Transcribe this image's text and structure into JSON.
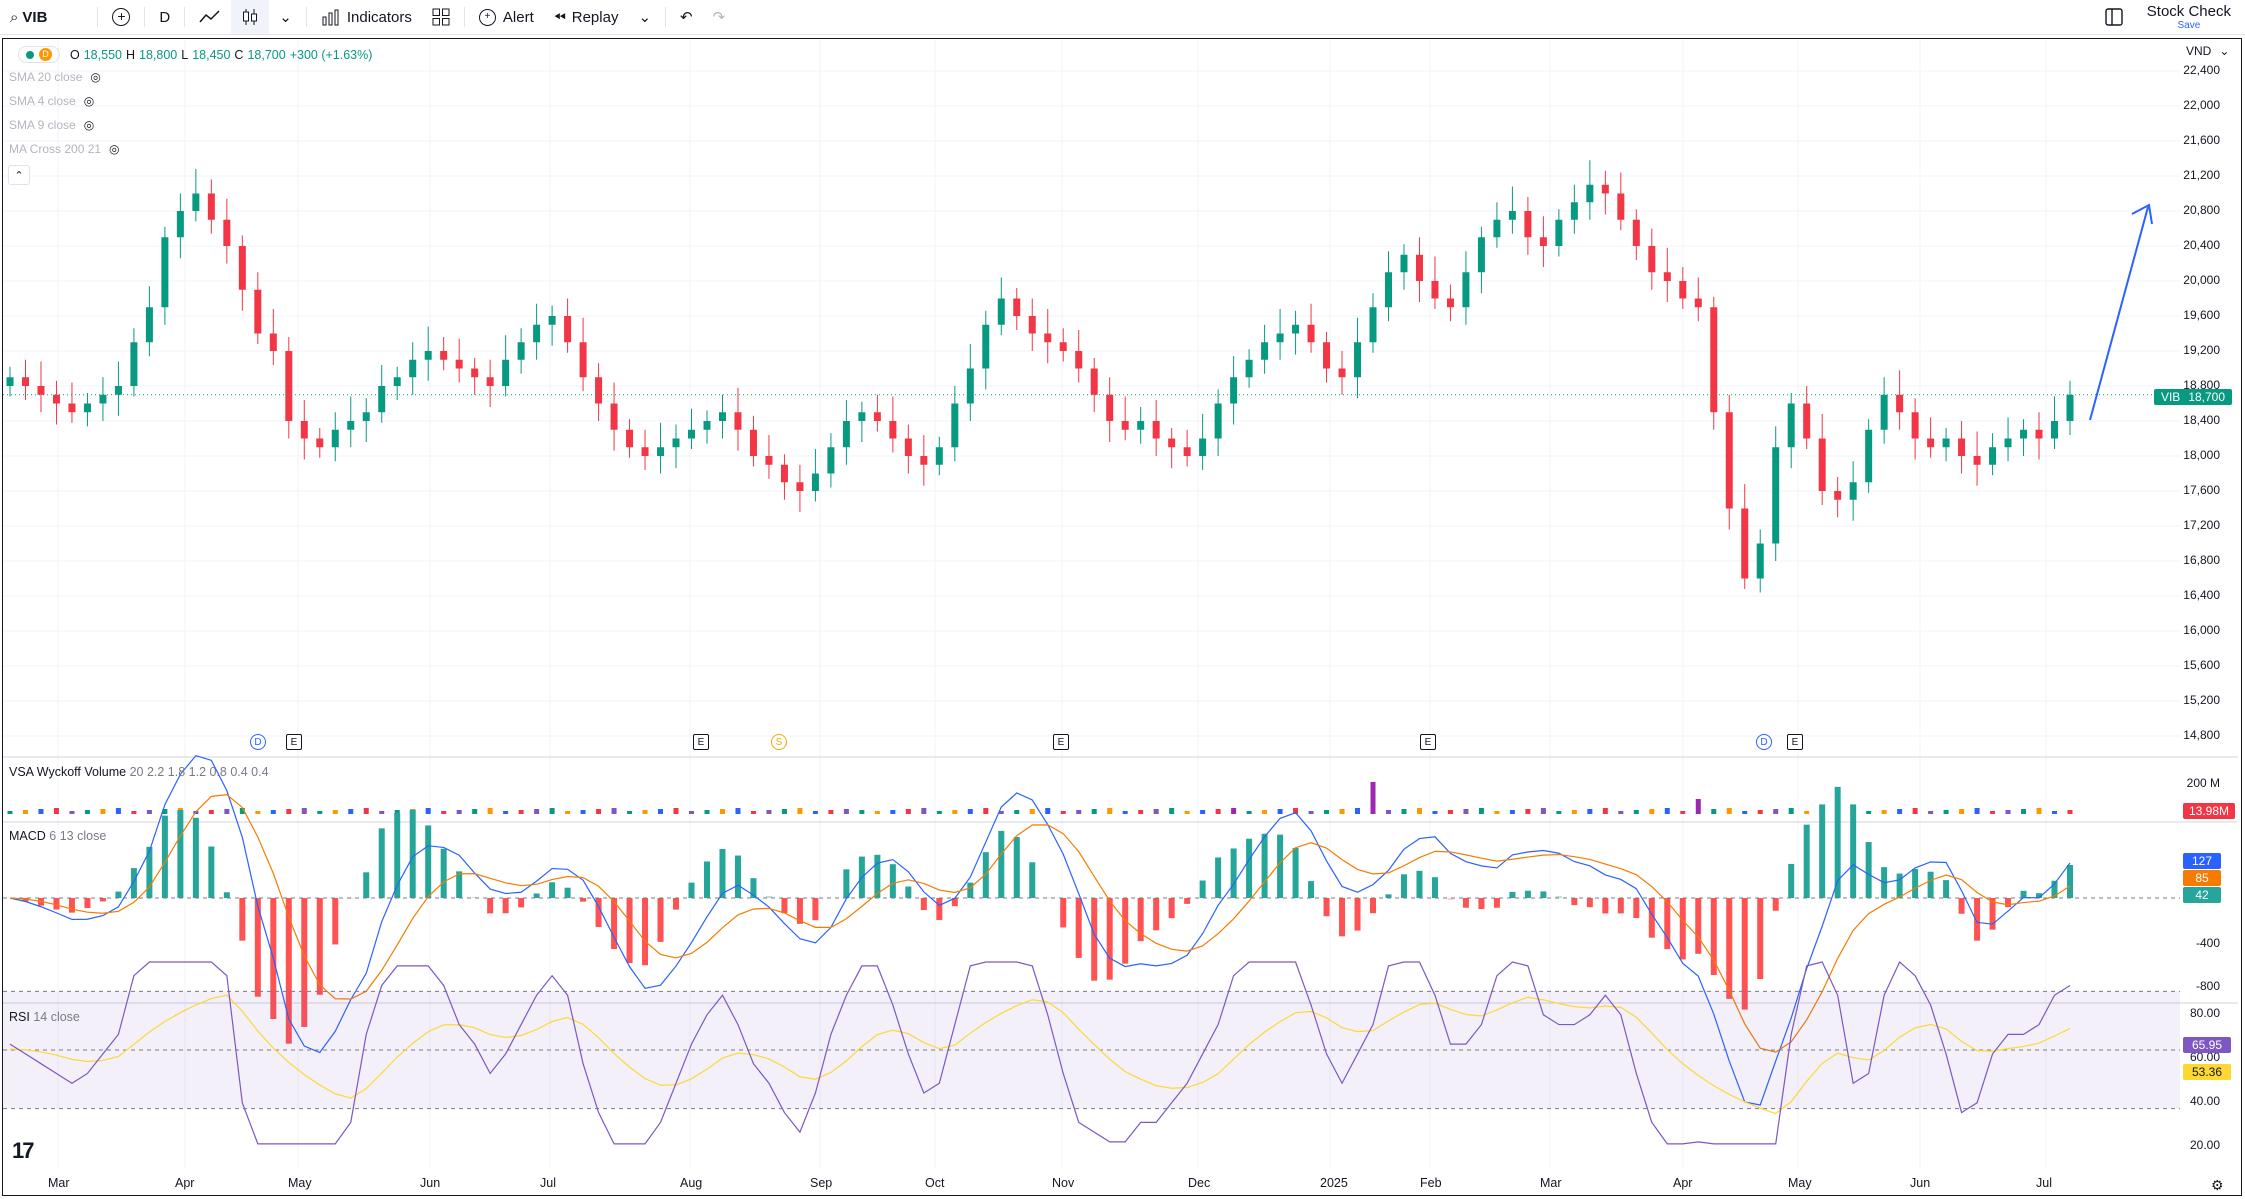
{
  "toolbar": {
    "symbol": "VIB",
    "interval": "D",
    "indicators_label": "Indicators",
    "alert_label": "Alert",
    "replay_label": "Replay",
    "layout_name": "Stock Check",
    "save_label": "Save"
  },
  "legend": {
    "interval_badge": "D",
    "open_label": "O",
    "open": "18,550",
    "high_label": "H",
    "high": "18,800",
    "low_label": "L",
    "low": "18,450",
    "close_label": "C",
    "close": "18,700",
    "change": "+300 (+1.63%)",
    "indicators": [
      "SMA 20 close",
      "SMA 4 close",
      "SMA 9 close",
      "MA Cross 200 21"
    ]
  },
  "currency": "VND",
  "price_axis": [
    "22,400",
    "22,000",
    "21,600",
    "21,200",
    "20,800",
    "20,400",
    "20,000",
    "19,600",
    "19,200",
    "18,800",
    "18,400",
    "18,000",
    "17,600",
    "17,200",
    "16,800",
    "16,400",
    "16,000",
    "15,600",
    "15,200",
    "14,800"
  ],
  "last_price_tag": {
    "symbol": "VIB",
    "price": "18,700",
    "color": "#089981"
  },
  "events": [
    {
      "type": "D",
      "shape": "circle",
      "color": "#2962ff"
    },
    {
      "type": "E",
      "shape": "square",
      "color": "#131722"
    },
    {
      "type": "E",
      "shape": "square",
      "color": "#131722"
    },
    {
      "type": "S",
      "shape": "circle",
      "color": "#f7a600"
    },
    {
      "type": "E",
      "shape": "square",
      "color": "#131722"
    },
    {
      "type": "E",
      "shape": "square",
      "color": "#131722"
    },
    {
      "type": "D",
      "shape": "circle",
      "color": "#2962ff"
    },
    {
      "type": "E",
      "shape": "square",
      "color": "#131722"
    }
  ],
  "volume_pane": {
    "title": "VSA Wyckoff Volume",
    "params": "20 2.2 1.8 1.2 0.8 0.4 0.4",
    "axis_label": "200 M",
    "last_tag": "13.98M"
  },
  "macd_pane": {
    "title": "MACD",
    "params": "6 13 close",
    "axis_labels": [
      "-400",
      "-800"
    ],
    "tags": [
      {
        "value": "127",
        "color": "#2962ff"
      },
      {
        "value": "85",
        "color": "#f57c00"
      },
      {
        "value": "42",
        "color": "#26a69a"
      }
    ]
  },
  "rsi_pane": {
    "title": "RSI",
    "params": "14 close",
    "axis_labels": [
      "80.00",
      "60.00",
      "40.00",
      "20.00"
    ],
    "tags": [
      {
        "value": "65.95",
        "color": "#7e57c2"
      },
      {
        "value": "53.36",
        "color": "#fdd835"
      }
    ]
  },
  "months": [
    "Mar",
    "Apr",
    "May",
    "Jun",
    "Jul",
    "Aug",
    "Sep",
    "Oct",
    "Nov",
    "Dec",
    "2025",
    "Feb",
    "Mar",
    "Apr",
    "May",
    "Jun",
    "Jul"
  ],
  "colors": {
    "up": "#089981",
    "down": "#f23645",
    "accent": "#2962ff",
    "rsi": "#7e57c2",
    "signal": "#fdd835"
  },
  "chart_data": {
    "type": "candlestick",
    "symbol": "VIB",
    "interval": "D",
    "closes_approx": [
      18900,
      18800,
      18700,
      18600,
      18500,
      18600,
      18700,
      18800,
      19300,
      19700,
      20500,
      20800,
      21000,
      20700,
      20400,
      19900,
      19400,
      19200,
      18400,
      18200,
      18100,
      18300,
      18400,
      18500,
      18800,
      18900,
      19100,
      19200,
      19100,
      19000,
      18900,
      18800,
      19100,
      19300,
      19500,
      19600,
      19300,
      18900,
      18600,
      18300,
      18100,
      18000,
      18100,
      18200,
      18300,
      18400,
      18500,
      18300,
      18000,
      17900,
      17700,
      17600,
      17800,
      18100,
      18400,
      18500,
      18400,
      18200,
      18000,
      17900,
      18100,
      18600,
      19000,
      19500,
      19800,
      19600,
      19400,
      19300,
      19200,
      19000,
      18700,
      18400,
      18300,
      18400,
      18200,
      18100,
      18000,
      18200,
      18600,
      18900,
      19100,
      19300,
      19400,
      19500,
      19300,
      19000,
      18900,
      19300,
      19700,
      20100,
      20300,
      20000,
      19800,
      19700,
      20100,
      20500,
      20700,
      20800,
      20500,
      20400,
      20700,
      20900,
      21100,
      21000,
      20700,
      20400,
      20100,
      20000,
      19800,
      19700,
      18500,
      17400,
      16600,
      17000,
      18100,
      18600,
      18200,
      17600,
      17500,
      17700,
      18300,
      18700,
      18500,
      18200,
      18100,
      18200,
      18000,
      17900,
      18100,
      18200,
      18300,
      18200,
      18400,
      18700
    ],
    "last": {
      "open": 18550,
      "high": 18800,
      "low": 18450,
      "close": 18700
    }
  }
}
